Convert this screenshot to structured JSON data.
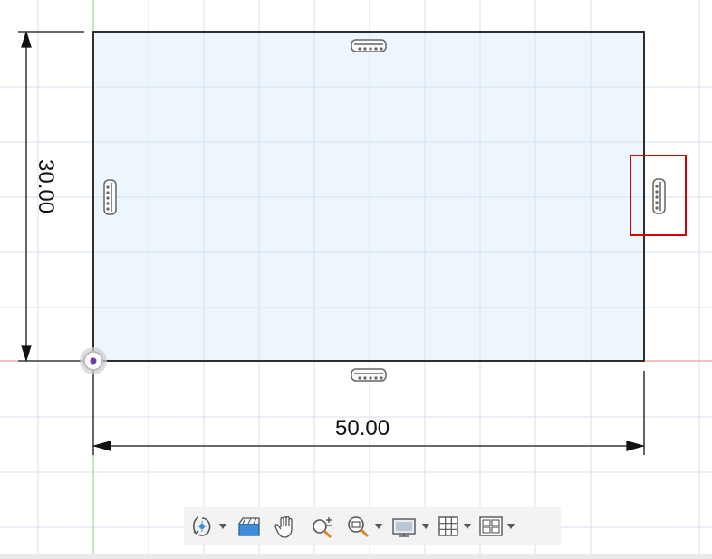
{
  "sketch": {
    "width_dimension": "50.00",
    "height_dimension": "30.00"
  },
  "constraints": {
    "top": "horizontal-constraint-icon",
    "bottom": "horizontal-constraint-icon",
    "left": "vertical-constraint-icon",
    "right": "vertical-constraint-icon"
  },
  "colors": {
    "rectangle_fill": "#eef6fd",
    "grid_line": "#d6e2ec",
    "x_axis": "#f08080",
    "y_axis": "#7ddc7d",
    "selection_highlight": "#d90000"
  },
  "toolbar": {
    "buttons": [
      {
        "name": "orbit-tool",
        "icon": "orbit-icon",
        "has_dropdown": true
      },
      {
        "name": "look-at-tool",
        "icon": "look-at-icon",
        "has_dropdown": false
      },
      {
        "name": "pan-tool",
        "icon": "hand-icon",
        "has_dropdown": false
      },
      {
        "name": "zoom-tool",
        "icon": "zoom-icon",
        "has_dropdown": false
      },
      {
        "name": "fit-tool",
        "icon": "fit-zoom-icon",
        "has_dropdown": true
      },
      {
        "name": "display-settings",
        "icon": "monitor-icon",
        "has_dropdown": true
      },
      {
        "name": "grid-settings",
        "icon": "grid-icon",
        "has_dropdown": true
      },
      {
        "name": "viewports",
        "icon": "viewports-icon",
        "has_dropdown": true
      }
    ]
  }
}
